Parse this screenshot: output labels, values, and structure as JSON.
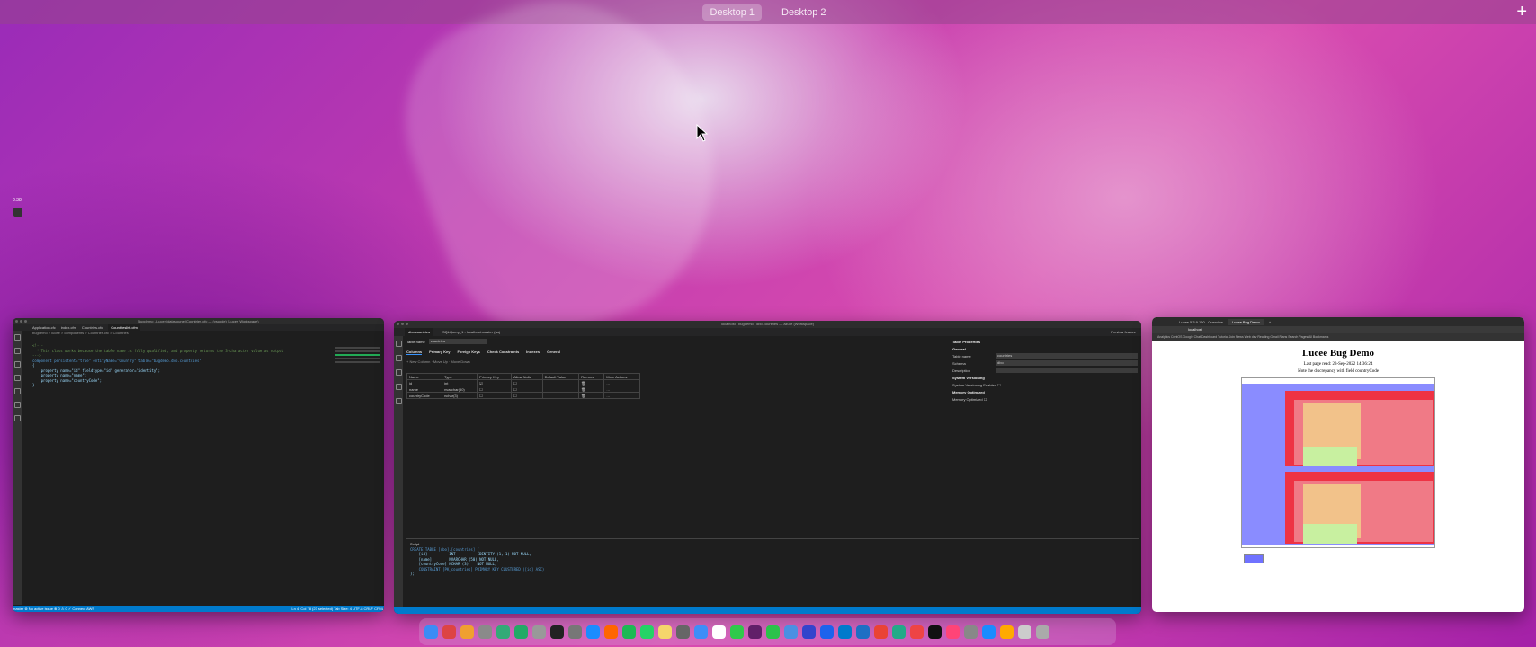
{
  "spaces": {
    "desktop1": "Desktop 1",
    "desktop2": "Desktop 2",
    "add": "+"
  },
  "side_clock": "8:38",
  "vscode": {
    "title": "Bugdemo - Lucee/datasource/Countries.cfc — (vscode) (Lucee Workspace)",
    "tabs": [
      "Application.cfc",
      "index.cfm",
      "Countries.cfc",
      "Countrieslist.cfm"
    ],
    "active_tab": "Countries.cfc",
    "breadcrumb": "bugdemo > lucee > components > Countries.cfc > Countries",
    "code": [
      "<!---",
      "  * This class works because the table name is fully qualified, and property returns the 3-character value as output",
      "--->",
      "component persistent=\"true\" entityName=\"Country\" table=\"bugdemo.dbo.countries\"",
      "{",
      "    property name=\"id\" fieldtype=\"id\" generator=\"identity\";",
      "    property name=\"name\";",
      "    property name=\"countryCode\";",
      "}"
    ],
    "status_left": "master  ⊗ No active issue  ⊗ 0 ⚠ 0  ✓ Connect  AWS",
    "status_right": "Ln 4, Col 78 (23 selected)  Tab Size: 4  UTF-8  CRLF  CFML"
  },
  "ads": {
    "title": "localhost : bugdemo : dbo.countries — azure (Workspace)",
    "tabs": [
      "dbo.countries",
      "SQLQuery_1 - localhost.master (sa)"
    ],
    "table_name_label": "Table name",
    "table_name_value": "countries",
    "sub_tabs": [
      "Columns",
      "Primary Key",
      "Foreign Keys",
      "Check Constraints",
      "Indexes",
      "General"
    ],
    "toolbar": "+ New Column  ·  Move Up  ·  Move Down",
    "columns_header": [
      "Name",
      "Type",
      "Primary Key",
      "Allow Nulls",
      "Default Value",
      "Remove",
      "More Actions"
    ],
    "columns": [
      [
        "id",
        "int"
      ],
      [
        "name",
        "nvarchar(50)"
      ],
      [
        "countryCode",
        "nchar(3)"
      ]
    ],
    "preview_label": "Preview feature",
    "properties": {
      "title": "Table Properties",
      "general": "General",
      "table_name": "Table name",
      "table_name_value": "countries",
      "schema": "Schema",
      "schema_value": "dbo",
      "description": "Description",
      "versioning": "System Versioning",
      "versioning_enabled": "System Versioning Enabled",
      "memory": "Memory Optimized",
      "memory_optimized": "Memory Optimized"
    },
    "script_label": "Script",
    "script": [
      "CREATE TABLE [dbo].[countries] (",
      "    [id]          INT          IDENTITY (1, 1) NOT NULL,",
      "    [name]        NVARCHAR (50) NOT NULL,",
      "    [countryCode] NCHAR (3)    NOT NULL,",
      "    CONSTRAINT [PK_countries] PRIMARY KEY CLUSTERED ([id] ASC)",
      ");",
      "",
      ""
    ]
  },
  "browser": {
    "tabs": [
      "Lucee 5.3.9.160 - Overview",
      "Lucee Bug Demo"
    ],
    "url": "localhost",
    "bookmarks": "Analytics  CentOS  Google  Chat Dashboard  Tutorial  Join  News  Web dev  Reading  Gmail  Plans  Search  Pages  All Bookmarks",
    "heading": "Lucee Bug Demo",
    "last_read": "Last page read: 23-Sep-2022 14:36:24",
    "note": "Note the discrepancy with field countryCode"
  },
  "dock": {
    "apps": [
      "finder-icon",
      "launchpad-icon",
      "app-icon",
      "settings-icon",
      "preview-icon",
      "app-icon",
      "app-icon",
      "terminal-icon",
      "activity-icon",
      "safari-icon",
      "firefox-icon",
      "spotify-icon",
      "whatsapp-icon",
      "notes-icon",
      "calc-icon",
      "mail-icon",
      "calendar-icon",
      "messages-icon",
      "slack-icon",
      "facetime-icon",
      "app-icon",
      "app-icon",
      "docker-icon",
      "vscode-icon",
      "ads-icon",
      "chrome-icon",
      "maps-icon",
      "app-icon",
      "terminal-icon",
      "app-icon",
      "app-icon",
      "safari-icon",
      "app-icon",
      "downloads-icon",
      "trash-icon"
    ],
    "colors": [
      "#3b8cf5",
      "#d44",
      "#f0a030",
      "#8a8a8a",
      "#3a7",
      "#2a6",
      "#999",
      "#222",
      "#777",
      "#1a8cff",
      "#f60",
      "#1db954",
      "#25d366",
      "#f5d66b",
      "#666",
      "#3e8ef7",
      "#fff",
      "#30c94b",
      "#611f69",
      "#2bc24a",
      "#4a90e2",
      "#34c",
      "#1d63ed",
      "#007acc",
      "#1e6fc4",
      "#ea4335",
      "#2a8",
      "#e44",
      "#111",
      "#f47",
      "#888",
      "#1a8cff",
      "#fa0",
      "#ccc",
      "#aaa"
    ]
  }
}
